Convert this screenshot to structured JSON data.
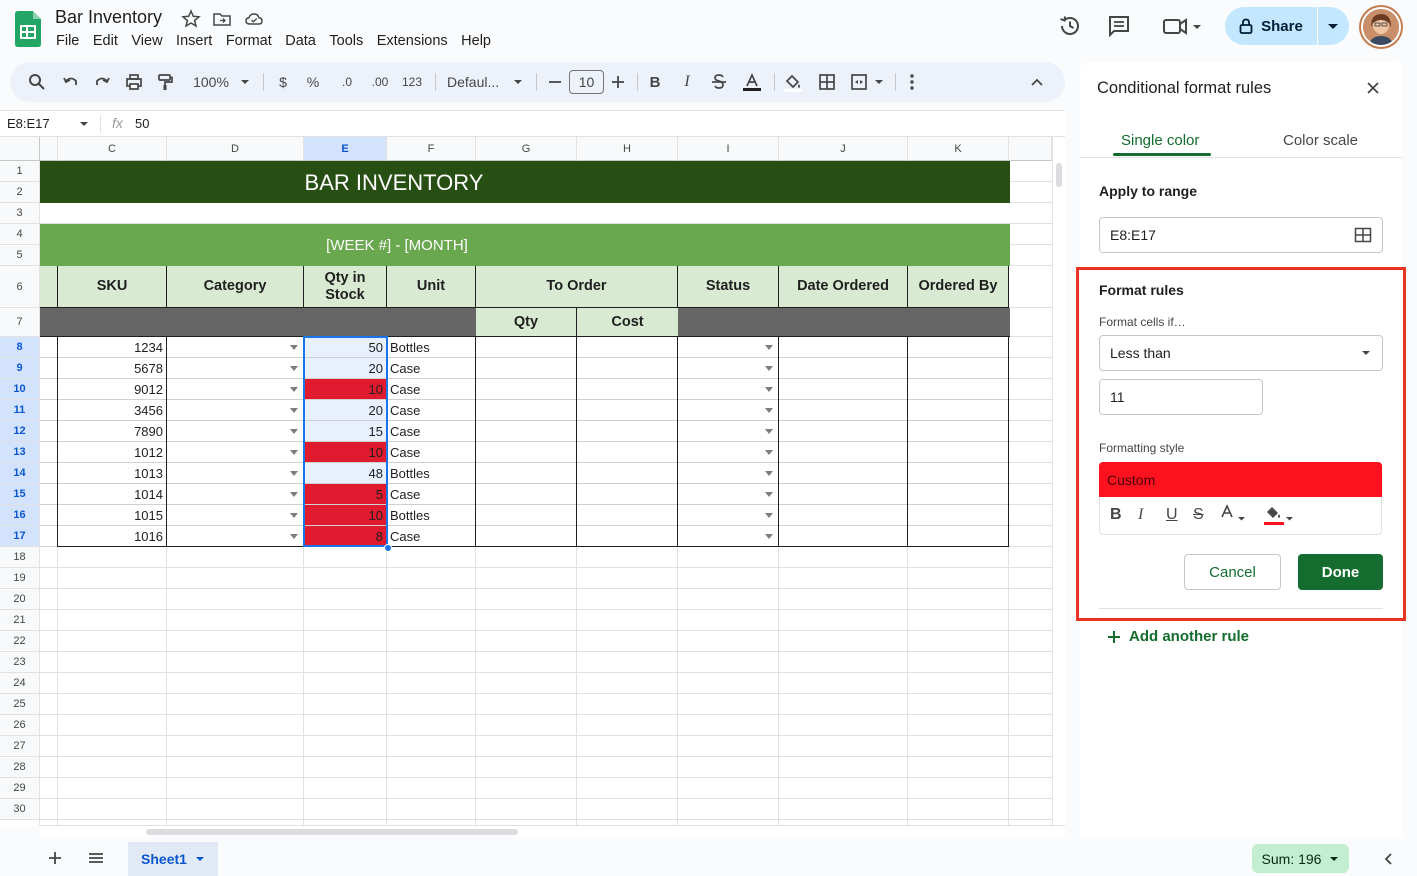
{
  "app": {
    "title": "Bar Inventory",
    "menu": [
      "File",
      "Edit",
      "View",
      "Insert",
      "Format",
      "Data",
      "Tools",
      "Extensions",
      "Help"
    ],
    "share_label": "Share"
  },
  "toolbar": {
    "zoom": "100%",
    "currency": "$",
    "percent": "%",
    "dec_decrease": ".0",
    "dec_increase": ".00",
    "number_format": "123",
    "font": "Defaul...",
    "font_size": "10",
    "bold": "B",
    "italic": "I"
  },
  "formula_bar": {
    "name_box": "E8:E17",
    "fx": "fx",
    "value": "50"
  },
  "sheet": {
    "columns": [
      "C",
      "D",
      "E",
      "F",
      "G",
      "H",
      "I",
      "J",
      "K"
    ],
    "rows": [
      "1",
      "2",
      "3",
      "4",
      "5",
      "6",
      "7",
      "8",
      "9",
      "10",
      "11",
      "12",
      "13",
      "14",
      "15",
      "16",
      "17",
      "18",
      "19",
      "20",
      "21",
      "22",
      "23",
      "24",
      "25",
      "26",
      "27",
      "28",
      "29",
      "30"
    ],
    "title": "BAR INVENTORY",
    "subtitle": "[WEEK #] - [MONTH]",
    "headers": {
      "sku": "SKU",
      "category": "Category",
      "qty_in_stock": "Qty in Stock",
      "unit": "Unit",
      "to_order": "To Order",
      "status": "Status",
      "date_ordered": "Date Ordered",
      "ordered_by": "Ordered By",
      "qty": "Qty",
      "cost": "Cost"
    },
    "data_rows": [
      {
        "sku": "1234",
        "qty": "50",
        "unit": "Bottles",
        "low": false
      },
      {
        "sku": "5678",
        "qty": "20",
        "unit": "Case",
        "low": false
      },
      {
        "sku": "9012",
        "qty": "10",
        "unit": "Case",
        "low": true
      },
      {
        "sku": "3456",
        "qty": "20",
        "unit": "Case",
        "low": false
      },
      {
        "sku": "7890",
        "qty": "15",
        "unit": "Case",
        "low": false
      },
      {
        "sku": "1012",
        "qty": "10",
        "unit": "Case",
        "low": true
      },
      {
        "sku": "1013",
        "qty": "48",
        "unit": "Bottles",
        "low": false
      },
      {
        "sku": "1014",
        "qty": "5",
        "unit": "Case",
        "low": true
      },
      {
        "sku": "1015",
        "qty": "10",
        "unit": "Bottles",
        "low": true
      },
      {
        "sku": "1016",
        "qty": "8",
        "unit": "Case",
        "low": true
      }
    ]
  },
  "panel": {
    "title": "Conditional format rules",
    "tab_single": "Single color",
    "tab_scale": "Color scale",
    "apply_label": "Apply to range",
    "apply_value": "E8:E17",
    "format_rules": "Format rules",
    "format_if": "Format cells if…",
    "condition": "Less than",
    "condition_value": "11",
    "formatting_style": "Formatting style",
    "style_name": "Custom",
    "cancel": "Cancel",
    "done": "Done",
    "add_rule": "Add another rule"
  },
  "bottom": {
    "sheet_name": "Sheet1",
    "sum": "Sum: 196"
  },
  "colors": {
    "header_dark": "#274e13",
    "header_green": "#6aa84f",
    "header_light": "#d9ead3",
    "gray_band": "#666666",
    "low_stock": "#e01b2f",
    "selection": "#e8f0fe",
    "accent": "#146c2e"
  }
}
